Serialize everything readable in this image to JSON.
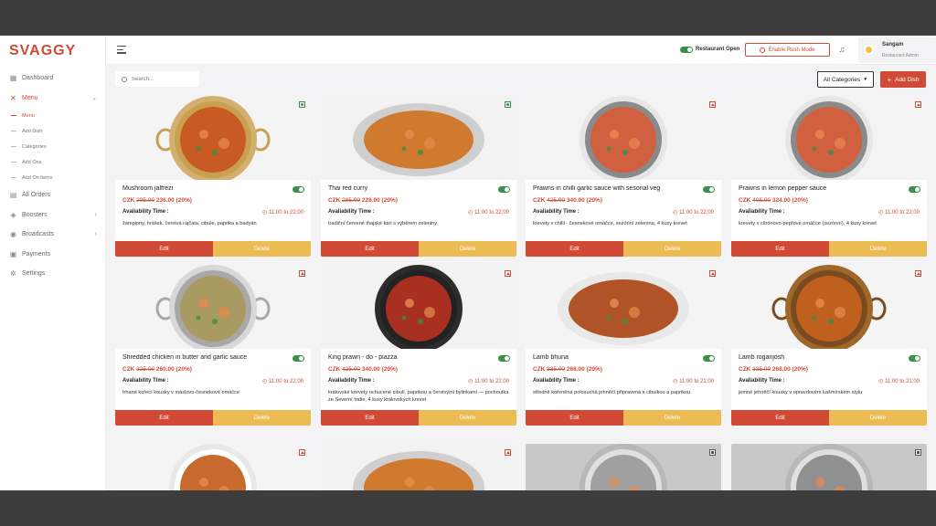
{
  "brand": {
    "logo": "SVAGGY",
    "accent": "#d04a35",
    "veg_color": "#3a8f4b",
    "delete_color": "#ecbb54"
  },
  "sidebar": {
    "items": [
      {
        "label": "Dashboard",
        "icon": "dashboard-icon"
      },
      {
        "label": "Menu",
        "icon": "fork-knife-icon",
        "active": true
      },
      {
        "label": "All Orders",
        "icon": "orders-icon"
      },
      {
        "label": "Boosters",
        "icon": "booster-icon"
      },
      {
        "label": "Broadcasts",
        "icon": "broadcast-icon"
      },
      {
        "label": "Payments",
        "icon": "payments-icon"
      },
      {
        "label": "Settings",
        "icon": "gear-icon"
      }
    ],
    "submenu": [
      "Menu",
      "Add Dish",
      "Categories",
      "Add Ons",
      "Add On Items"
    ]
  },
  "header": {
    "status_label": "Restaurant Open",
    "rush_button": "Enable Rush Mode",
    "user_name": "Sangam",
    "user_role": "Restaurant Admin"
  },
  "toolbar": {
    "search_placeholder": "Search...",
    "category_select": "All Categories",
    "add_button": "Add Dish"
  },
  "labels": {
    "availability": "Avaliability Time :",
    "edit": "Edit",
    "delete": "Delete"
  },
  "dishes": [
    {
      "name": "Mushroom jalfrezi",
      "old_price": "295.00",
      "new_price": "236.00 (20%)",
      "currency": "CZK",
      "time": "11:00 to 22:00",
      "desc": "žampiony, hrášek, čerstvá rajčata, cibule, paprika a badyán",
      "type": "veg"
    },
    {
      "name": "Thai red curry",
      "old_price": "285.00",
      "new_price": "228.00 (20%)",
      "currency": "CZK",
      "time": "11:00 to 22:00",
      "desc": "tradiční červené thajské kari s výběrem zeleniny",
      "type": "veg"
    },
    {
      "name": "Prawns in chilli garlic sauce with sesonal veg",
      "old_price": "425.00",
      "new_price": "340.00 (20%)",
      "currency": "CZK",
      "time": "11:00 to 22:00",
      "desc": "krevety v chilli - česnekové omáčce, sezónní zelenina, 4 kusy krevet",
      "type": "nonveg"
    },
    {
      "name": "Prawns in lemon pepper sauce",
      "old_price": "405.00",
      "new_price": "324.00 (20%)",
      "currency": "CZK",
      "time": "11:00 to 22:00",
      "desc": "krevety v citrónovo-pepřové omáčce (sezónní), 4 kusy krevet",
      "type": "nonveg"
    },
    {
      "name": "Shredded chicken in butter and garlic sauce",
      "old_price": "325.00",
      "new_price": "260.00 (20%)",
      "currency": "CZK",
      "time": "11:00 to 22:00",
      "desc": "trhané kuřecí kousky v máslovo-česnekové omáčce",
      "type": "nonveg"
    },
    {
      "name": "King prawn - do - piazza",
      "old_price": "425.00",
      "new_price": "340.00 (20%)",
      "currency": "CZK",
      "time": "11:00 to 22:00",
      "desc": "královské krevety ochucené cibulí, paprikou a čerstvými bylinkami — pochoutka ze Severní Indie, 4 kusy královských krevet",
      "type": "nonveg"
    },
    {
      "name": "Lamb bhuna",
      "old_price": "335.00",
      "new_price": "268.00 (20%)",
      "currency": "CZK",
      "time": "11:00 to 21:00",
      "desc": "středně kořeněná polosuchá jehněčí připravená s cibulkou a paprikou",
      "type": "nonveg"
    },
    {
      "name": "Lamb roganjosh",
      "old_price": "335.00",
      "new_price": "268.00 (20%)",
      "currency": "CZK",
      "time": "11:00 to 21:00",
      "desc": "jemné jehněčí kousky v opravdovém kašmírském stylu",
      "type": "nonveg"
    }
  ],
  "partial_cards": [
    {
      "type": "nonveg"
    },
    {
      "type": "nonveg"
    },
    {
      "type": "grey"
    },
    {
      "type": "grey"
    }
  ]
}
